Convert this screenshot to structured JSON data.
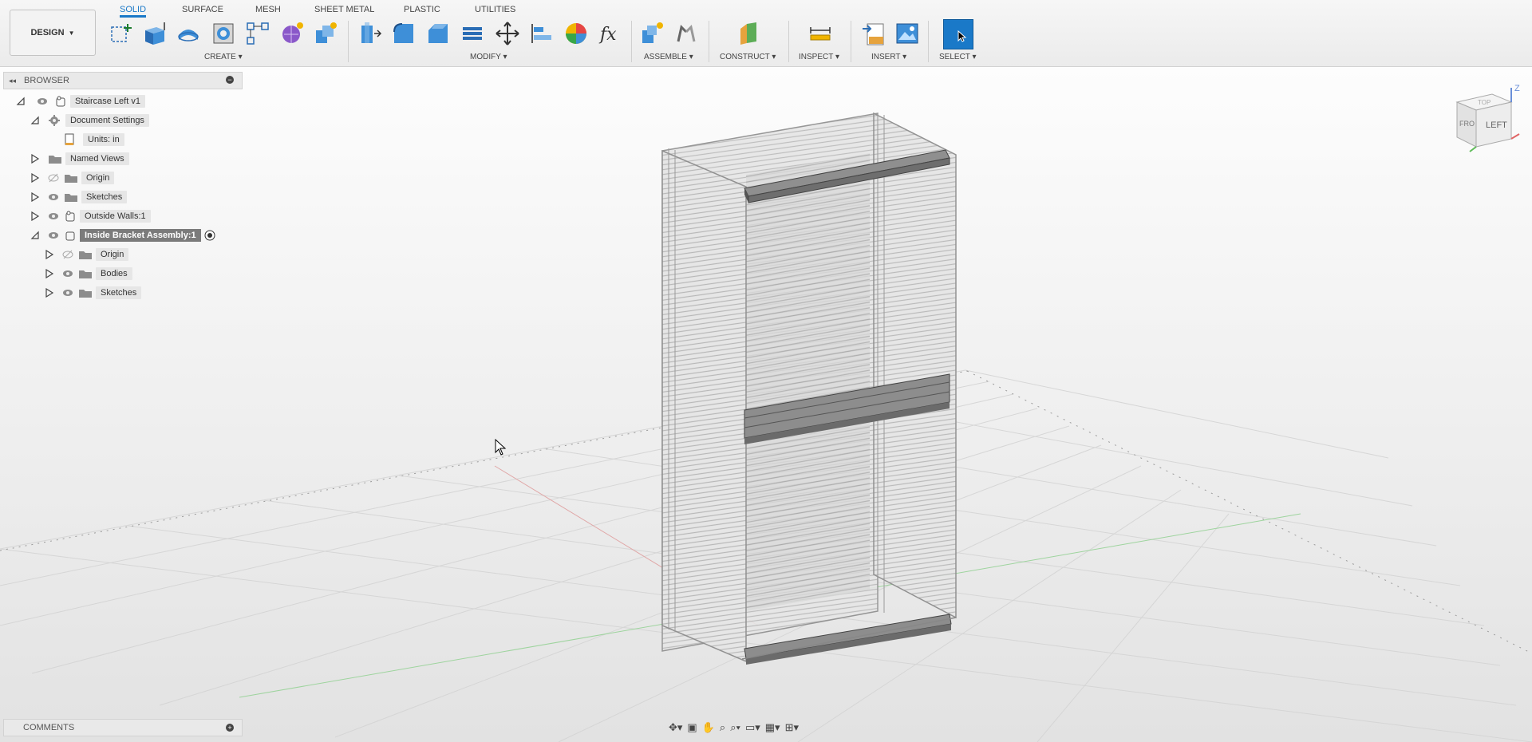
{
  "toolbar": {
    "design_label": "DESIGN",
    "tabs": [
      "SOLID",
      "SURFACE",
      "MESH",
      "SHEET METAL",
      "PLASTIC",
      "UTILITIES"
    ],
    "groups": {
      "create": "CREATE",
      "modify": "MODIFY",
      "assemble": "ASSEMBLE",
      "construct": "CONSTRUCT",
      "inspect": "INSPECT",
      "insert": "INSERT",
      "select": "SELECT"
    },
    "accent": "#1a79c8"
  },
  "browser": {
    "title": "BROWSER",
    "items": [
      {
        "label": "Staircase Left v1"
      },
      {
        "label": "Document Settings"
      },
      {
        "label": "Units: in"
      },
      {
        "label": "Named Views"
      },
      {
        "label": "Origin"
      },
      {
        "label": "Sketches"
      },
      {
        "label": "Outside Walls:1"
      },
      {
        "label": "Inside Bracket Assembly:1"
      },
      {
        "label": "Origin"
      },
      {
        "label": "Bodies"
      },
      {
        "label": "Sketches"
      }
    ]
  },
  "comments": {
    "title": "COMMENTS"
  },
  "viewcube": {
    "face_label": "LEFT",
    "side_label": "FRO",
    "top_label": "TOP",
    "axis_label": "Z"
  }
}
